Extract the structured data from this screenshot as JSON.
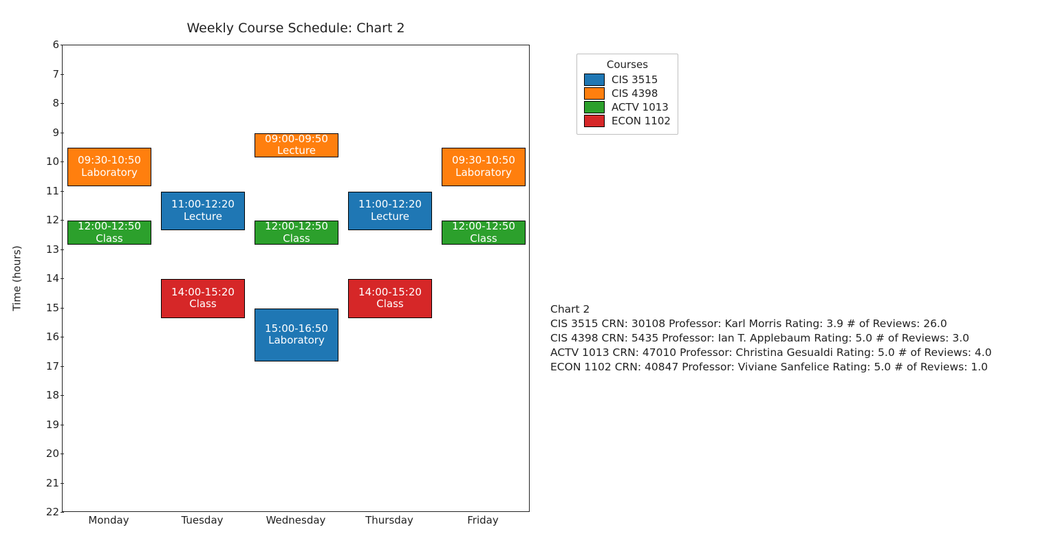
{
  "chart_data": {
    "type": "schedule",
    "title": "Weekly Course Schedule: Chart 2",
    "ylabel": "Time (hours)",
    "xlabel": "",
    "y_axis": {
      "min": 6,
      "max": 22,
      "inverted": true,
      "ticks": [
        6,
        7,
        8,
        9,
        10,
        11,
        12,
        13,
        14,
        15,
        16,
        17,
        18,
        19,
        20,
        21,
        22
      ]
    },
    "days": [
      "Monday",
      "Tuesday",
      "Wednesday",
      "Thursday",
      "Friday"
    ],
    "day_slot_width": 0.9,
    "courses": [
      {
        "id": "CIS 3515",
        "color": "#1f77b4"
      },
      {
        "id": "CIS 4398",
        "color": "#ff7f0e"
      },
      {
        "id": "ACTV 1013",
        "color": "#2ca02c"
      },
      {
        "id": "ECON 1102",
        "color": "#d62728"
      }
    ],
    "blocks": [
      {
        "course": "CIS 4398",
        "day": "Monday",
        "start": 9.5,
        "end": 10.833,
        "time_label": "09:30-10:50",
        "type": "Laboratory"
      },
      {
        "course": "ACTV 1013",
        "day": "Monday",
        "start": 12.0,
        "end": 12.833,
        "time_label": "12:00-12:50",
        "type": "Class"
      },
      {
        "course": "CIS 3515",
        "day": "Tuesday",
        "start": 11.0,
        "end": 12.333,
        "time_label": "11:00-12:20",
        "type": "Lecture"
      },
      {
        "course": "ECON 1102",
        "day": "Tuesday",
        "start": 14.0,
        "end": 15.333,
        "time_label": "14:00-15:20",
        "type": "Class"
      },
      {
        "course": "CIS 4398",
        "day": "Wednesday",
        "start": 9.0,
        "end": 9.833,
        "time_label": "09:00-09:50",
        "type": "Lecture"
      },
      {
        "course": "ACTV 1013",
        "day": "Wednesday",
        "start": 12.0,
        "end": 12.833,
        "time_label": "12:00-12:50",
        "type": "Class"
      },
      {
        "course": "CIS 3515",
        "day": "Wednesday",
        "start": 15.0,
        "end": 16.833,
        "time_label": "15:00-16:50",
        "type": "Laboratory"
      },
      {
        "course": "CIS 3515",
        "day": "Thursday",
        "start": 11.0,
        "end": 12.333,
        "time_label": "11:00-12:20",
        "type": "Lecture"
      },
      {
        "course": "ECON 1102",
        "day": "Thursday",
        "start": 14.0,
        "end": 15.333,
        "time_label": "14:00-15:20",
        "type": "Class"
      },
      {
        "course": "CIS 4398",
        "day": "Friday",
        "start": 9.5,
        "end": 10.833,
        "time_label": "09:30-10:50",
        "type": "Laboratory"
      },
      {
        "course": "ACTV 1013",
        "day": "Friday",
        "start": 12.0,
        "end": 12.833,
        "time_label": "12:00-12:50",
        "type": "Class"
      }
    ],
    "legend": {
      "title": "Courses",
      "position": "upper-right-outside"
    }
  },
  "info_panel": {
    "heading": "Chart 2",
    "lines": [
      "CIS 3515 CRN: 30108 Professor: Karl Morris Rating: 3.9 # of Reviews: 26.0",
      "CIS 4398 CRN: 5435 Professor: Ian T. Applebaum Rating: 5.0 # of Reviews: 3.0",
      "ACTV 1013 CRN: 47010 Professor: Christina Gesualdi Rating: 5.0 # of Reviews: 4.0",
      "ECON 1102 CRN: 40847 Professor: Viviane Sanfelice Rating: 5.0 # of Reviews: 1.0"
    ]
  }
}
